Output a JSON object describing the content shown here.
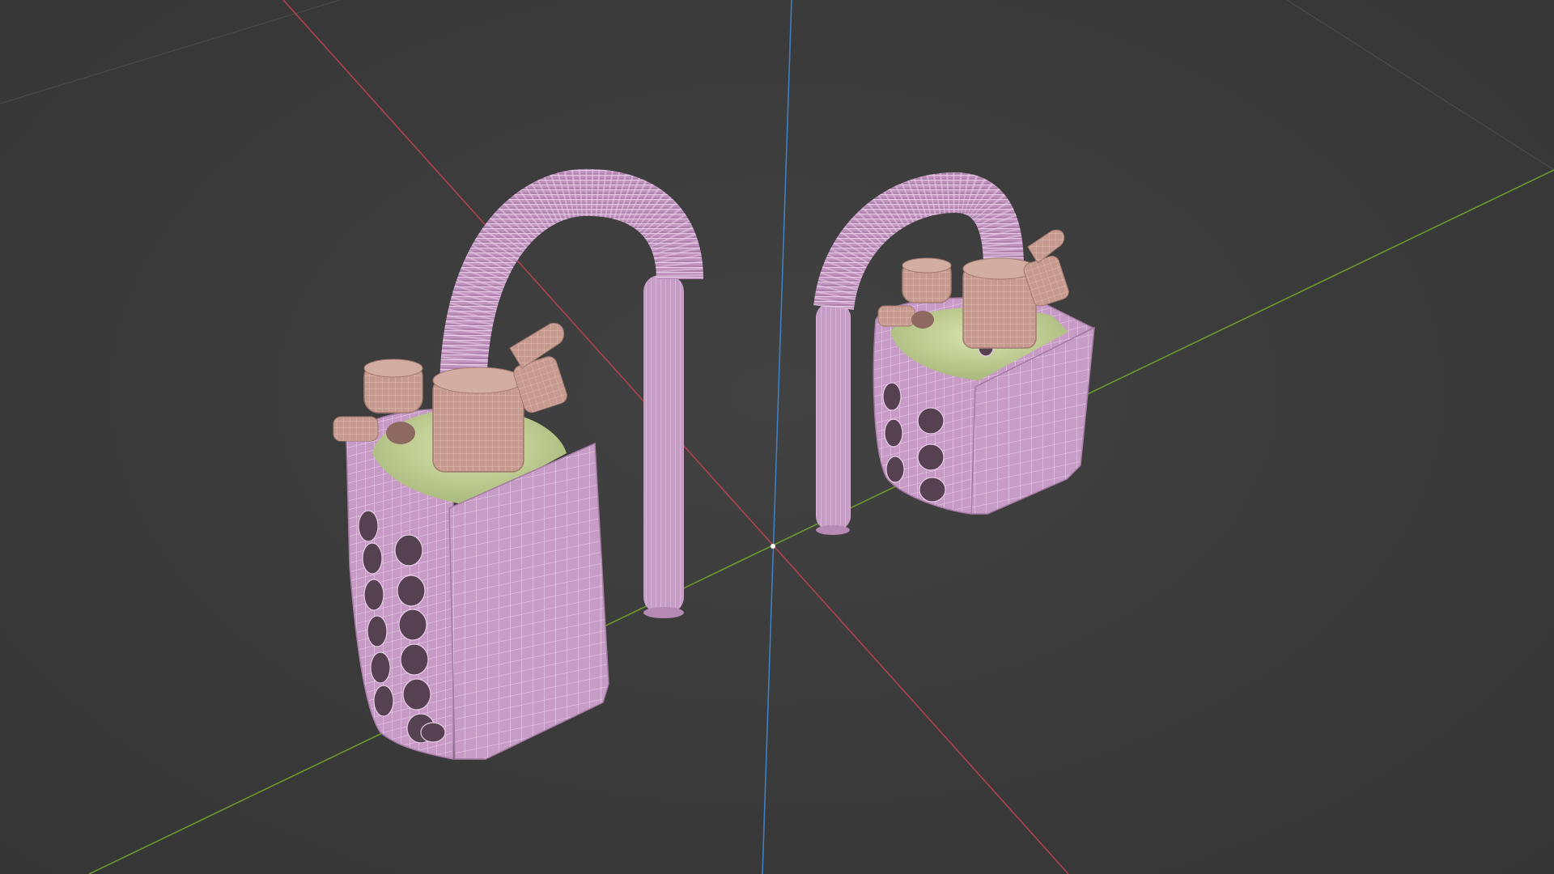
{
  "viewport": {
    "background": "#3d3d3d",
    "grid_color": "#4a4a4a",
    "axis_x_color": "#b0414e",
    "axis_y_color": "#6a9a2a",
    "axis_z_color": "#3d7fc4",
    "mesh_color": "#c9a0c8",
    "wire_color": "#e6c6e6",
    "fitting_color": "#c89a90",
    "fluid_color": "#c6d49a",
    "mode": "wireframe-overlay"
  },
  "scene": {
    "objects": [
      {
        "name": "oxygen-tank-large",
        "icon": "mesh-object-icon"
      },
      {
        "name": "oxygen-tank-small",
        "icon": "mesh-object-icon"
      }
    ]
  }
}
